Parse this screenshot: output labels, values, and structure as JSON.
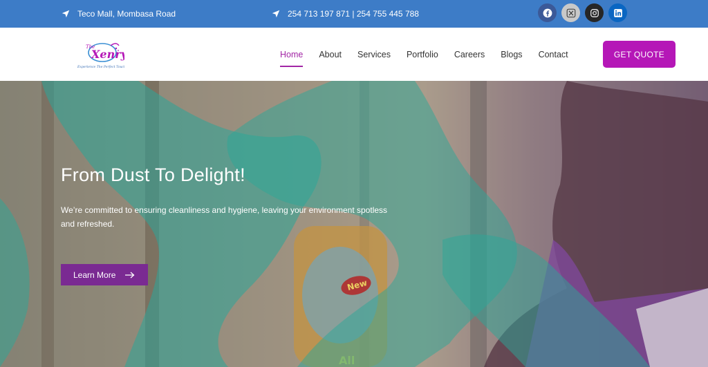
{
  "topbar": {
    "address": "Teco Mall, Mombasa Road",
    "phone": "254 713 197 871 | 254 755 445 788",
    "socials": [
      {
        "name": "facebook-icon",
        "bg": "#3b5998"
      },
      {
        "name": "x-icon",
        "bg": "#c9c9c9"
      },
      {
        "name": "instagram-icon",
        "bg": "#262626"
      },
      {
        "name": "linkedin-icon",
        "bg": "#0a66c2"
      }
    ]
  },
  "header": {
    "logo_text": "Xenry",
    "logo_prefix": "The",
    "logo_tagline": "Experience The Perfect Touch",
    "nav": [
      "Home",
      "About",
      "Services",
      "Portfolio",
      "Careers",
      "Blogs",
      "Contact"
    ],
    "active_nav": "Home",
    "cta": "GET QUOTE"
  },
  "hero": {
    "title": "From Dust To Delight!",
    "text": "We’re committed to ensuring cleanliness and hygiene, leaving your environment spotless and refreshed.",
    "button": "Learn More",
    "bottle_label": "New"
  },
  "colors": {
    "topbar": "#3d7cc7",
    "accent": "#b517b7",
    "active_nav": "#a226a5",
    "hero_button": "#7a2a92",
    "glove_overlay": "#2fb5a6"
  }
}
